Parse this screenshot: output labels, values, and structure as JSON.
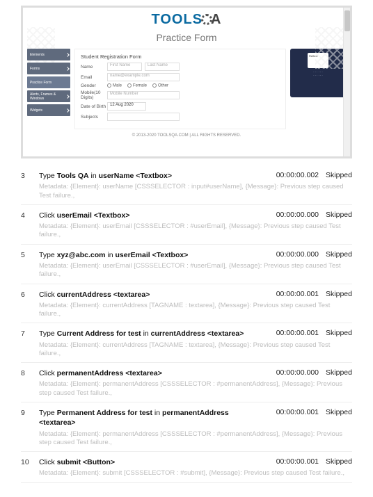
{
  "embed": {
    "logo_part1": "TOOLS",
    "logo_part2": "A",
    "subtitle": "Practice Form",
    "sidebar": [
      {
        "label": "Elements"
      },
      {
        "label": "Forms"
      },
      {
        "label": "Practice Form"
      },
      {
        "label": "Alerts, Frames & Windows"
      },
      {
        "label": "Widgets"
      }
    ],
    "form": {
      "title": "Student Registration Form",
      "name_label": "Name",
      "first_name_ph": "First Name",
      "last_name_ph": "Last Name",
      "email_label": "Email",
      "email_ph": "name@example.com",
      "gender_label": "Gender",
      "gender_opts": [
        "Male",
        "Female",
        "Other"
      ],
      "mobile_label": "Mobile(10 Digits)",
      "mobile_ph": "Mobile Number",
      "dob_label": "Date of Birth",
      "dob_value": "12 Aug 2020",
      "subjects_label": "Subjects"
    },
    "ad": {
      "tag": "Reflect"
    },
    "copyright": "© 2013-2020 TOOLSQA.COM | ALL RIGHTS RESERVED."
  },
  "log": [
    {
      "n": "3",
      "action_pre": "Type ",
      "action_bold": "Tools QA",
      "action_mid": " in ",
      "action_bold2": "userName <Textbox>",
      "duration": "00:00:00.002",
      "status": "Skipped",
      "meta": "Metadata: {Element}: userName [CSSSELECTOR : input#userName], {Message}: Previous step caused Test failure.,"
    },
    {
      "n": "4",
      "action_pre": "Click ",
      "action_bold": "userEmail <Textbox>",
      "action_mid": "",
      "action_bold2": "",
      "duration": "00:00:00.000",
      "status": "Skipped",
      "meta": "Metadata: {Element}: userEmail [CSSSELECTOR : #userEmail], {Message}: Previous step caused Test failure.,"
    },
    {
      "n": "5",
      "action_pre": "Type ",
      "action_bold": "xyz@abc.com",
      "action_mid": " in ",
      "action_bold2": "userEmail <Textbox>",
      "duration": "00:00:00.000",
      "status": "Skipped",
      "meta": "Metadata: {Element}: userEmail [CSSSELECTOR : #userEmail], {Message}: Previous step caused Test failure.,"
    },
    {
      "n": "6",
      "action_pre": "Click ",
      "action_bold": "currentAddress <textarea>",
      "action_mid": "",
      "action_bold2": "",
      "duration": "00:00:00.001",
      "status": "Skipped",
      "meta": "Metadata: {Element}: currentAddress [TAGNAME : textarea], {Message}: Previous step caused Test failure.,"
    },
    {
      "n": "7",
      "action_pre": "Type ",
      "action_bold": "Current Address for test",
      "action_mid": " in ",
      "action_bold2": "currentAddress <textarea>",
      "duration": "00:00:00.001",
      "status": "Skipped",
      "meta": "Metadata: {Element}: currentAddress [TAGNAME : textarea], {Message}: Previous step caused Test failure.,"
    },
    {
      "n": "8",
      "action_pre": "Click ",
      "action_bold": "permanentAddress <textarea>",
      "action_mid": "",
      "action_bold2": "",
      "duration": "00:00:00.000",
      "status": "Skipped",
      "meta": "Metadata: {Element}: permanentAddress [CSSSELECTOR : #permanentAddress], {Message}: Previous step caused Test failure.,"
    },
    {
      "n": "9",
      "action_pre": "Type ",
      "action_bold": "Permanent Address for test",
      "action_mid": " in ",
      "action_bold2": "permanentAddress <textarea>",
      "duration": "00:00:00.001",
      "status": "Skipped",
      "meta": "Metadata: {Element}: permanentAddress [CSSSELECTOR : #permanentAddress], {Message}: Previous step caused Test failure.,"
    },
    {
      "n": "10",
      "action_pre": "Click ",
      "action_bold": "submit <Button>",
      "action_mid": "",
      "action_bold2": "",
      "duration": "00:00:00.001",
      "status": "Skipped",
      "meta": "Metadata: {Element}: submit [CSSSELECTOR : #submit], {Message}: Previous step caused Test failure.,"
    }
  ]
}
